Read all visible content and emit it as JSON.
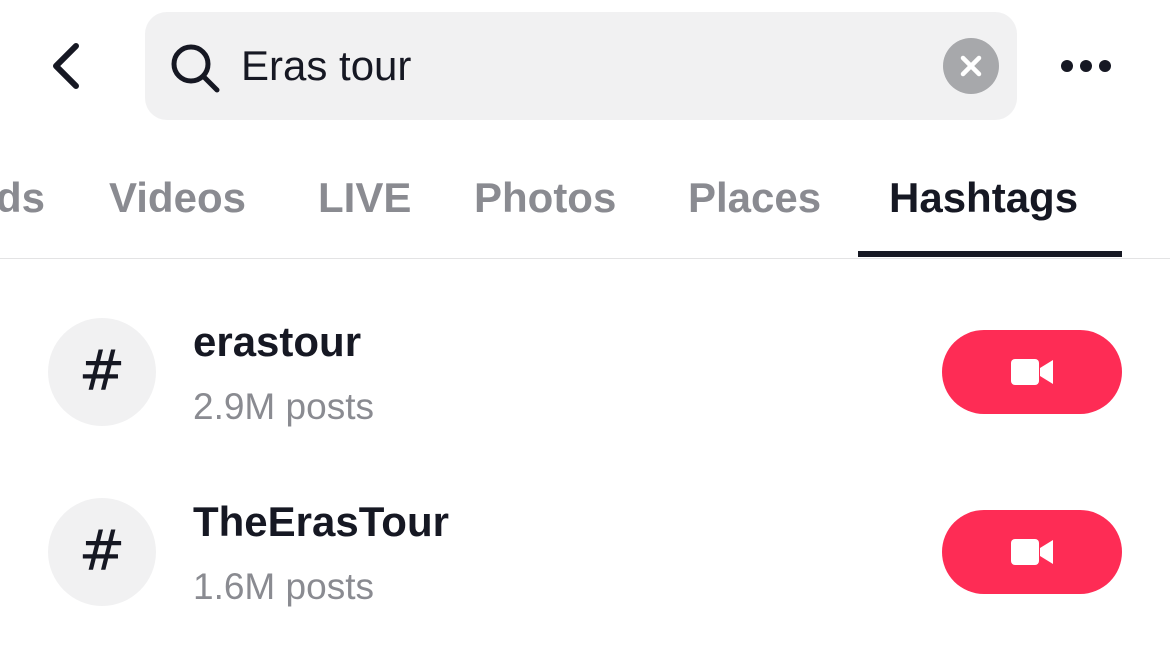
{
  "search": {
    "value": "Eras tour",
    "placeholder": "Search"
  },
  "icons": {
    "back": "chevron-left-icon",
    "search": "magnifier-icon",
    "clear": "x-circle-icon",
    "more": "ellipsis-icon",
    "hashtag": "hash-icon",
    "record": "video-camera-icon"
  },
  "tabs": [
    {
      "label": "ds",
      "active": false
    },
    {
      "label": "Videos",
      "active": false
    },
    {
      "label": "LIVE",
      "active": false
    },
    {
      "label": "Photos",
      "active": false
    },
    {
      "label": "Places",
      "active": false
    },
    {
      "label": "Hashtags",
      "active": true
    }
  ],
  "results": [
    {
      "symbol": "#",
      "title": "erastour",
      "subtitle": "2.9M posts"
    },
    {
      "symbol": "#",
      "title": "TheErasTour",
      "subtitle": "1.6M posts"
    }
  ],
  "colors": {
    "accent": "#fe2c55",
    "text_primary": "#161823",
    "text_secondary": "#8a8b91",
    "surface": "#f1f1f2"
  }
}
